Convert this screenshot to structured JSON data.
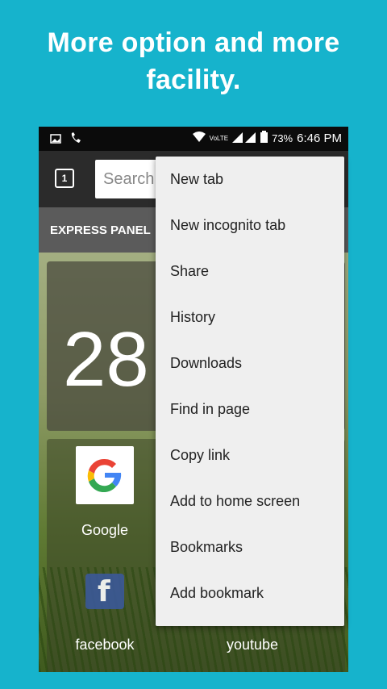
{
  "headline": {
    "line1": "More option and more",
    "line2": "facility."
  },
  "statusbar": {
    "network": "VoLTE",
    "battery": "73%",
    "time": "6:46 PM"
  },
  "toolbar": {
    "tab_count": "1",
    "search_placeholder": "Search"
  },
  "content": {
    "panel_tab": "EXPRESS PANEL",
    "big_number": "28",
    "sites": [
      "Google",
      "facebook",
      "youtube"
    ]
  },
  "menu": {
    "items": [
      "New tab",
      "New incognito tab",
      "Share",
      "History",
      "Downloads",
      "Find in page",
      "Copy link",
      "Add to home screen",
      "Bookmarks",
      "Add bookmark"
    ]
  }
}
